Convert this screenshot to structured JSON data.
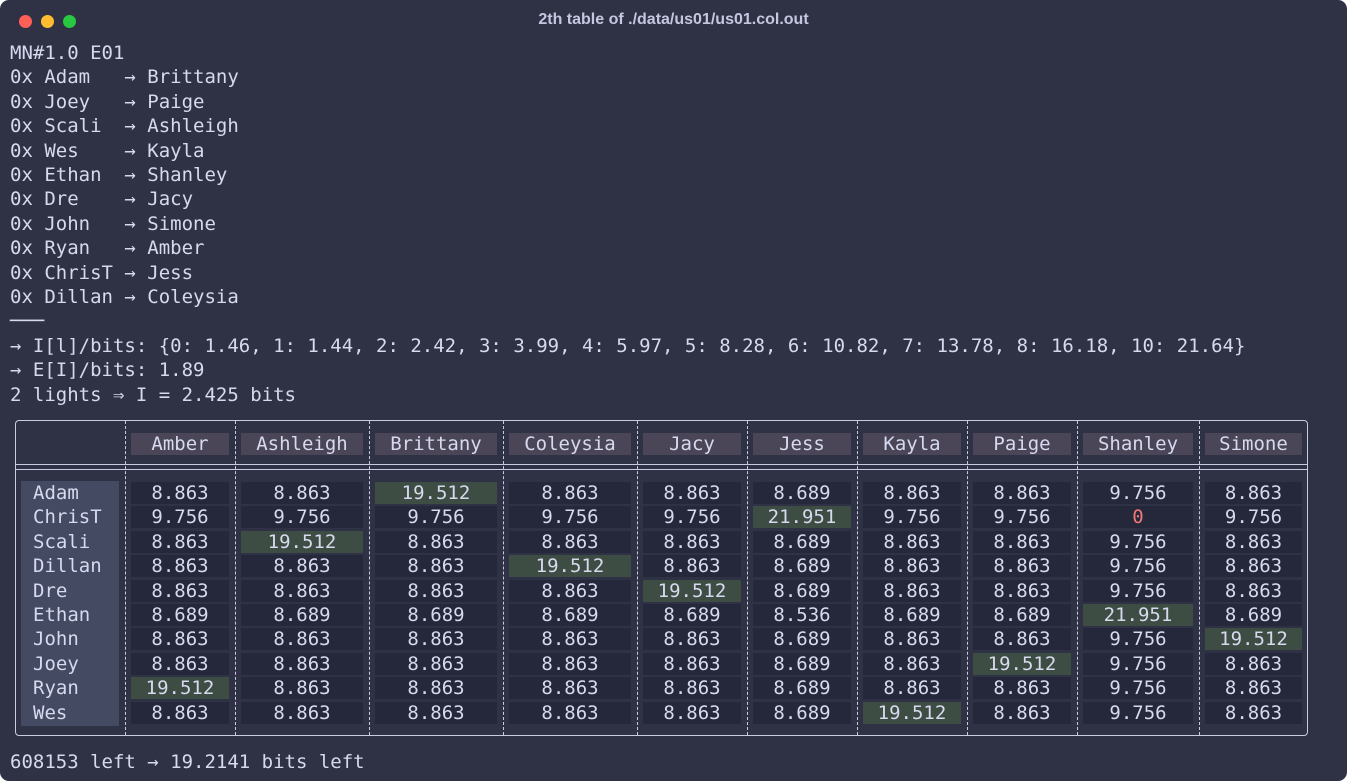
{
  "window": {
    "title": "2th table of ./data/us01/us01.col.out"
  },
  "header_lines": [
    "MN#1.0 E01",
    "0x Adam   → Brittany",
    "0x Joey   → Paige",
    "0x Scali  → Ashleigh",
    "0x Wes    → Kayla",
    "0x Ethan  → Shanley",
    "0x Dre    → Jacy",
    "0x John   → Simone",
    "0x Ryan   → Amber",
    "0x ChrisT → Jess",
    "0x Dillan → Coleysia",
    "───",
    "→ I[l]/bits: {0: 1.46, 1: 1.44, 2: 2.42, 3: 3.99, 4: 5.97, 5: 8.28, 6: 10.82, 7: 13.78, 8: 16.18, 10: 21.64}",
    "→ E[I]/bits: 1.89",
    "2 lights ⇒ I = 2.425 bits"
  ],
  "table": {
    "columns": [
      "Amber",
      "Ashleigh",
      "Brittany",
      "Coleysia",
      "Jacy",
      "Jess",
      "Kayla",
      "Paige",
      "Shanley",
      "Simone"
    ],
    "rows": [
      {
        "name": "Adam",
        "values": [
          "8.863",
          "8.863",
          "19.512",
          "8.863",
          "8.863",
          "8.689",
          "8.863",
          "8.863",
          "9.756",
          "8.863"
        ]
      },
      {
        "name": "ChrisT",
        "values": [
          "9.756",
          "9.756",
          "9.756",
          "9.756",
          "9.756",
          "21.951",
          "9.756",
          "9.756",
          "0",
          "9.756"
        ]
      },
      {
        "name": "Scali",
        "values": [
          "8.863",
          "19.512",
          "8.863",
          "8.863",
          "8.863",
          "8.689",
          "8.863",
          "8.863",
          "9.756",
          "8.863"
        ]
      },
      {
        "name": "Dillan",
        "values": [
          "8.863",
          "8.863",
          "8.863",
          "19.512",
          "8.863",
          "8.689",
          "8.863",
          "8.863",
          "9.756",
          "8.863"
        ]
      },
      {
        "name": "Dre",
        "values": [
          "8.863",
          "8.863",
          "8.863",
          "8.863",
          "19.512",
          "8.689",
          "8.863",
          "8.863",
          "9.756",
          "8.863"
        ]
      },
      {
        "name": "Ethan",
        "values": [
          "8.689",
          "8.689",
          "8.689",
          "8.689",
          "8.689",
          "8.536",
          "8.689",
          "8.689",
          "21.951",
          "8.689"
        ]
      },
      {
        "name": "John",
        "values": [
          "8.863",
          "8.863",
          "8.863",
          "8.863",
          "8.863",
          "8.689",
          "8.863",
          "8.863",
          "9.756",
          "19.512"
        ]
      },
      {
        "name": "Joey",
        "values": [
          "8.863",
          "8.863",
          "8.863",
          "8.863",
          "8.863",
          "8.689",
          "8.863",
          "19.512",
          "9.756",
          "8.863"
        ]
      },
      {
        "name": "Ryan",
        "values": [
          "19.512",
          "8.863",
          "8.863",
          "8.863",
          "8.863",
          "8.689",
          "8.863",
          "8.863",
          "9.756",
          "8.863"
        ]
      },
      {
        "name": "Wes",
        "values": [
          "8.863",
          "8.863",
          "8.863",
          "8.863",
          "8.863",
          "8.689",
          "19.512",
          "8.863",
          "9.756",
          "8.863"
        ]
      }
    ],
    "highlight_color": "#3e4d43",
    "zero_color": "#f07878"
  },
  "footer": "608153 left → 19.2141 bits left",
  "colors": {
    "background": "#2f3245",
    "text": "#d7d9ee",
    "header_cell": "#4a4658",
    "value_cell": "#25273a"
  }
}
